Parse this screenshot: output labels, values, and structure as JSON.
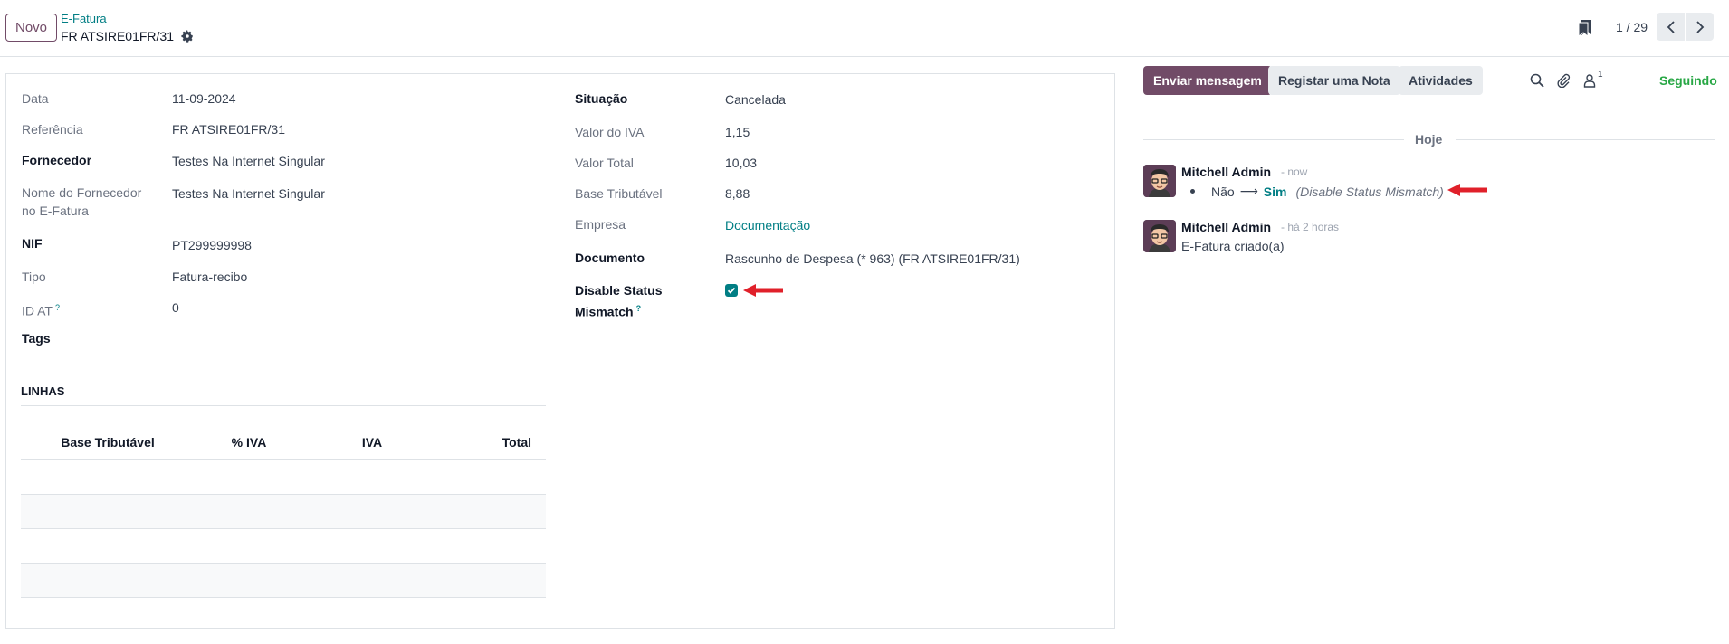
{
  "control_panel": {
    "new_button": "Novo",
    "breadcrumb_parent": "E-Fatura",
    "record_name": "FR ATSIRE01FR/31",
    "pager_value": "1 / 29"
  },
  "form": {
    "left": [
      {
        "label": "Data",
        "value": "11-09-2024"
      },
      {
        "label": "Referência",
        "value": "FR ATSIRE01FR/31"
      },
      {
        "label": "Fornecedor",
        "value": "Testes Na Internet Singular"
      },
      {
        "label": "Nome do Fornecedor no E-Fatura",
        "value": "Testes Na Internet Singular"
      },
      {
        "label": "NIF",
        "value": "PT299999998"
      },
      {
        "label": "Tipo",
        "value": "Fatura-recibo"
      },
      {
        "label": "ID AT",
        "value": "0",
        "help": "?"
      },
      {
        "label": "Tags",
        "value": ""
      }
    ],
    "right": [
      {
        "label": "Situação",
        "value": "Cancelada"
      },
      {
        "label": "Valor do IVA",
        "value": "1,15"
      },
      {
        "label": "Valor Total",
        "value": "10,03"
      },
      {
        "label": "Base Tributável",
        "value": "8,88"
      },
      {
        "label": "Empresa",
        "value": "Documentação"
      },
      {
        "label": "Documento",
        "value": "Rascunho de Despesa (* 963) (FR ATSIRE01FR/31)"
      },
      {
        "label": "Disable Status Mismatch",
        "value": "",
        "help": "?",
        "checked": true
      }
    ],
    "lines_section_title": "LINHAS",
    "lines_columns": [
      "Base Tributável",
      "% IVA",
      "IVA",
      "Total"
    ]
  },
  "chatter": {
    "send_message": "Enviar mensagem",
    "log_note": "Registar uma Nota",
    "activities": "Atividades",
    "followers_count": "1",
    "follow_status": "Seguindo",
    "date_separator": "Hoje",
    "messages": [
      {
        "author": "Mitchell Admin",
        "time": "- now",
        "tracking": {
          "old": "Não",
          "arrow": "⟶",
          "new": "Sim",
          "field": "(Disable Status Mismatch)"
        }
      },
      {
        "author": "Mitchell Admin",
        "time": "- há 2 horas",
        "body": "E-Fatura criado(a)"
      }
    ]
  },
  "colors": {
    "primary": "#714b67",
    "link": "#017e84",
    "follow": "#28a745",
    "annotation_arrow": "#e0202a"
  }
}
